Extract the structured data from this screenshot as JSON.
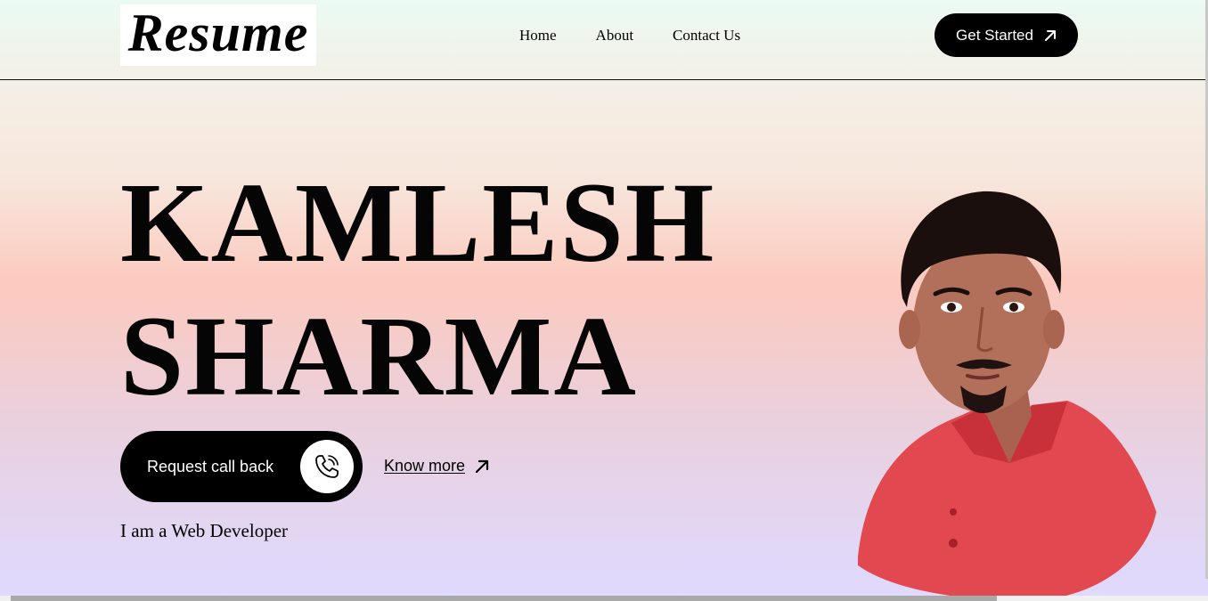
{
  "header": {
    "logo_text": "Resume",
    "nav": [
      {
        "label": "Home"
      },
      {
        "label": "About"
      },
      {
        "label": "Contact Us"
      }
    ],
    "cta_label": "Get Started",
    "cta_icon": "arrow-up-right-icon"
  },
  "hero": {
    "first_name": "KAMLESH",
    "last_name": "SHARMA",
    "callback_label": "Request call back",
    "callback_icon": "phone-call-icon",
    "know_more_label": "Know more",
    "know_more_icon": "arrow-up-right-icon",
    "tagline": "I am a Web Developer"
  },
  "colors": {
    "button_bg": "#000000",
    "button_text": "#ffffff",
    "shirt": "#e2484f",
    "bg_top": "#ebfaf3",
    "bg_mid": "#fccabf",
    "bg_bottom": "#dfdaff"
  }
}
